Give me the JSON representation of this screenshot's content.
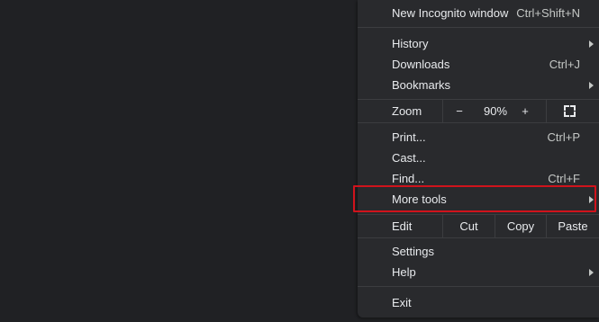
{
  "menu": {
    "new_incognito": {
      "label": "New Incognito window",
      "shortcut": "Ctrl+Shift+N"
    },
    "history": {
      "label": "History"
    },
    "downloads": {
      "label": "Downloads",
      "shortcut": "Ctrl+J"
    },
    "bookmarks": {
      "label": "Bookmarks"
    },
    "zoom": {
      "label": "Zoom",
      "minus": "−",
      "value": "90%",
      "plus": "+"
    },
    "print": {
      "label": "Print...",
      "shortcut": "Ctrl+P"
    },
    "cast": {
      "label": "Cast..."
    },
    "find": {
      "label": "Find...",
      "shortcut": "Ctrl+F"
    },
    "more_tools": {
      "label": "More tools"
    },
    "edit": {
      "label": "Edit",
      "cut": "Cut",
      "copy": "Copy",
      "paste": "Paste"
    },
    "settings": {
      "label": "Settings"
    },
    "help": {
      "label": "Help"
    },
    "exit": {
      "label": "Exit"
    }
  },
  "colors": {
    "background": "#202124",
    "menu_background": "#292a2d",
    "text": "#e8eaed",
    "separator": "#3c3d40",
    "highlight_border": "#d0131c"
  },
  "icons": {
    "submenu_arrow": "chevron-right-icon",
    "fullscreen": "fullscreen-icon"
  }
}
